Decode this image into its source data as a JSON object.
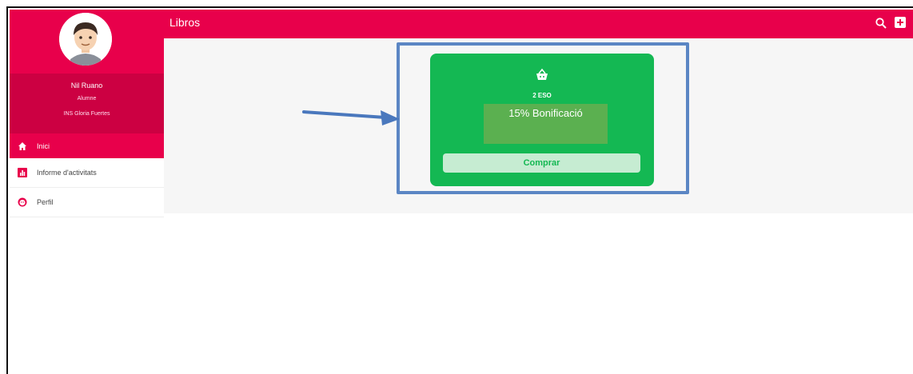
{
  "sidebar": {
    "user": {
      "name": "Nil Ruano",
      "role": "Alumne",
      "school": "INS Gloria Fuertes"
    },
    "items": [
      {
        "label": "Inici",
        "icon": "home-icon",
        "active": true
      },
      {
        "label": "Informe d'activitats",
        "icon": "chart-icon",
        "active": false
      },
      {
        "label": "Perfil",
        "icon": "face-icon",
        "active": false
      }
    ]
  },
  "topbar": {
    "title": "Libros",
    "actions": [
      "search-icon",
      "add-box-icon"
    ]
  },
  "card": {
    "icon": "basket-icon",
    "course": "2 ESO",
    "bonus": "15% Bonificació",
    "button_label": "Comprar"
  },
  "colors": {
    "primary": "#e8004b",
    "primary_dark": "#cc0042",
    "card": "#14b853",
    "bonus_box": "#5bb050",
    "highlight": "#5b86c4"
  }
}
